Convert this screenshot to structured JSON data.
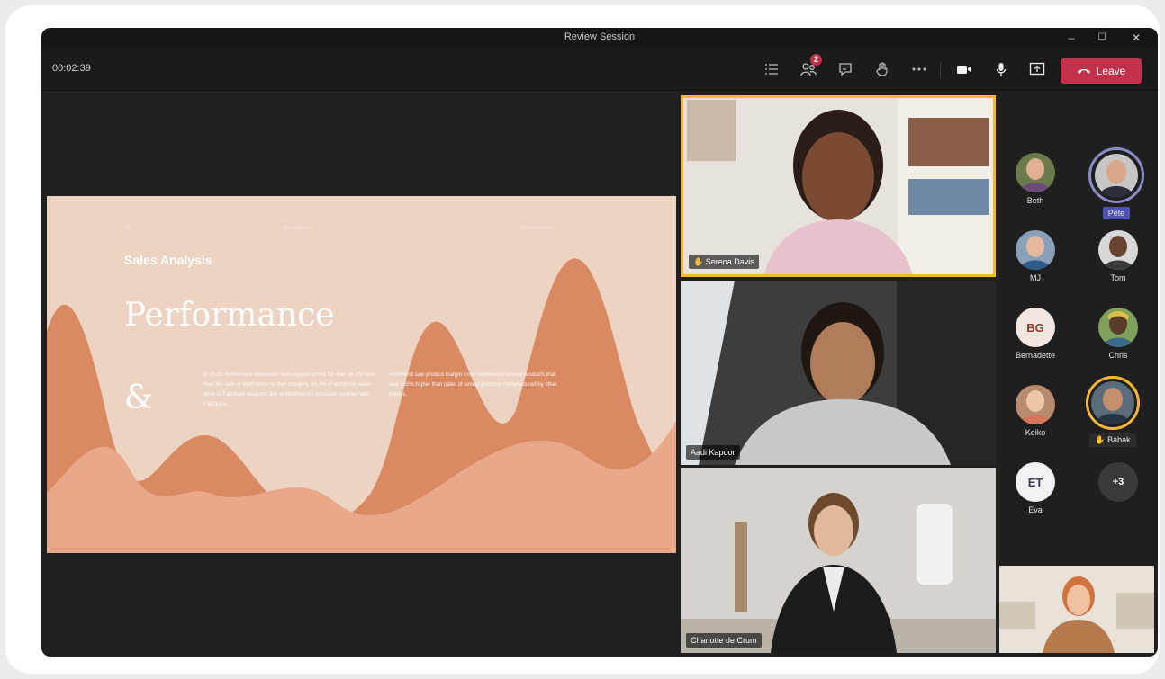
{
  "window": {
    "title": "Review Session",
    "controls": {
      "minimize": "–",
      "maximize": "☐",
      "close": "✕"
    }
  },
  "toolbar": {
    "timer": "00:02:39",
    "participants_badge": "2",
    "leave_label": "Leave",
    "icons": [
      "list-icon",
      "people-icon",
      "chat-icon",
      "raise-hand-icon",
      "more-icon",
      "camera-icon",
      "mic-icon",
      "share-icon",
      "phone-hangup-icon"
    ]
  },
  "slide": {
    "small_left": "01",
    "small_center": "Woodlander",
    "small_right": "Sales Analysis",
    "subtitle": "Sales Analysis",
    "title": "Performance",
    "amp": "&",
    "para1": "In 2018, Northwind's worldwide sales topped $5BN. Of that, 36.7% was from the sale of electronics. In that category, 88.5% of electronic sales were of Fabrikam products due to Northwind's exclusive contract with Fabrikam.",
    "para2": "Northwind saw product margin from Fabrikam-produced products that was 135% higher than sales of similar products manufactured by other brands."
  },
  "video_tiles": [
    {
      "name": "Serena Davis",
      "hand_raised": true,
      "active_speaker": true
    },
    {
      "name": "Aadi Kapoor",
      "hand_raised": false
    },
    {
      "name": "Charlotte de Crum",
      "hand_raised": false
    }
  ],
  "roster": [
    {
      "name": "Beth"
    },
    {
      "name": "Pete",
      "highlighted": true
    },
    {
      "name": "MJ"
    },
    {
      "name": "Tom"
    },
    {
      "name": "Bernadette",
      "initials": "BG"
    },
    {
      "name": "Chris"
    },
    {
      "name": "Keiko"
    },
    {
      "name": "Babak",
      "hand_raised": true
    },
    {
      "name": "Eva",
      "initials": "ET"
    },
    {
      "overflow": "+3"
    }
  ],
  "colors": {
    "leave": "#c4314b",
    "speaker_ring": "#f7b731",
    "pete_ring": "#8b8cc7",
    "slide_bg": "#ecd3c2",
    "wave_dark": "#d98a63",
    "wave_light": "#eaa88a"
  }
}
